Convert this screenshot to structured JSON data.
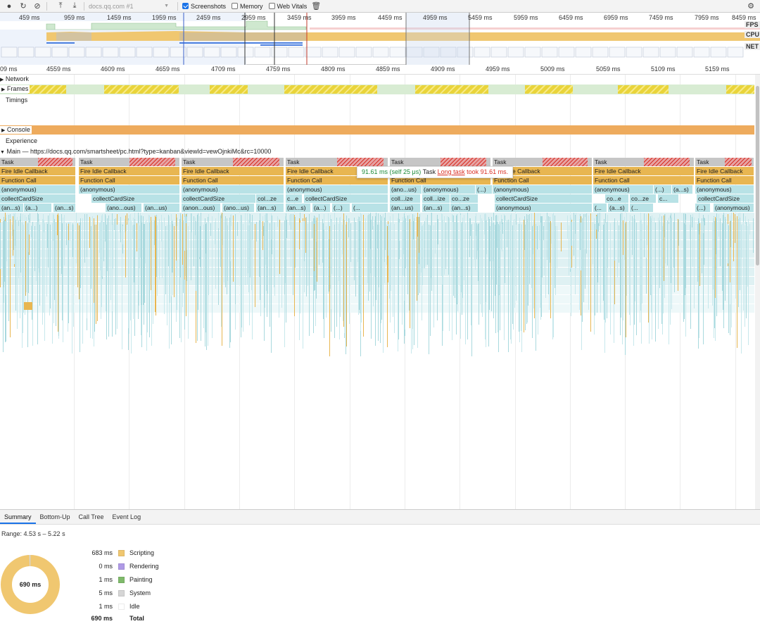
{
  "toolbar": {
    "tab_select": "docs.qq.com #1",
    "screenshots_label": "Screenshots",
    "screenshots_checked": true,
    "memory_label": "Memory",
    "memory_checked": false,
    "webvitals_label": "Web Vitals",
    "webvitals_checked": false
  },
  "overview": {
    "ticks": [
      "459 ms",
      "959 ms",
      "1459 ms",
      "1959 ms",
      "2459 ms",
      "2959 ms",
      "3459 ms",
      "3959 ms",
      "4459 ms",
      "4959 ms",
      "5459 ms",
      "5959 ms",
      "6459 ms",
      "6959 ms",
      "7459 ms",
      "7959 ms",
      "8459 ms"
    ],
    "labels": {
      "fps": "FPS",
      "cpu": "CPU",
      "net": "NET"
    }
  },
  "ruler": {
    "ticks": [
      "09 ms",
      "4559 ms",
      "4609 ms",
      "4659 ms",
      "4709 ms",
      "4759 ms",
      "4809 ms",
      "4859 ms",
      "4909 ms",
      "4959 ms",
      "5009 ms",
      "5059 ms",
      "5109 ms",
      "5159 ms"
    ]
  },
  "tracks": {
    "network": "Network",
    "frames": "Frames",
    "timings": "Timings",
    "console": "Console",
    "experience": "Experience",
    "main": "Main — https://docs.qq.com/smartsheet/pc.html?type=kanban&viewId=vewOjnkiMc&rc=10000"
  },
  "flame": {
    "task": "Task",
    "fire_idle": "Fire Idle Callback",
    "function_call": "Function Call",
    "anonymous": "(anonymous)",
    "collect": "collectCardSize",
    "row6_col0": [
      "(an...s)",
      "(a...)",
      "(an...s)"
    ],
    "row6_col1": [
      "(ano...ous)",
      "(an...us)"
    ],
    "row6_col2": [
      "(anon...ous)",
      "(ano...us)",
      "(an...s)"
    ],
    "row6_col3": [
      "(an...s)",
      "(a...)",
      "(...)",
      "(..."
    ],
    "row6_col4": [
      "(an...us)",
      "(an...s)",
      "(an...s)"
    ],
    "row6_col5": [
      "(anonymous)"
    ],
    "row6_col6": [
      "(...",
      "(a...s)",
      "(..."
    ],
    "row6_col7": [
      "(...)",
      "(anonymous)"
    ],
    "row4_col4": [
      "(ano...us)",
      "(anonymous)",
      "(...)"
    ],
    "row4_col6": [
      "(anonymous)",
      "(...)",
      "(a...s)"
    ],
    "row5_col2b": "col...ze",
    "row5_col3": [
      "c...e",
      "collectCardSize"
    ],
    "row5_col4": [
      "coll...ize",
      "coll...ize",
      "co...ze"
    ],
    "row5_col5": "collectCardSize",
    "row5_col6": [
      "co...e",
      "co...ze",
      "c..."
    ],
    "row5_col7": "collectCardSize"
  },
  "tooltip": {
    "time": "91.61 ms (self 25 μs)",
    "name": "Task",
    "link": "Long task",
    "rest": "took 91.61 ms."
  },
  "bottom": {
    "tabs": [
      "Summary",
      "Bottom-Up",
      "Call Tree",
      "Event Log"
    ],
    "range": "Range: 4.53 s – 5.22 s",
    "donut_total": "690 ms",
    "legend": [
      {
        "value": "683 ms",
        "label": "Scripting",
        "color": "#f0c770"
      },
      {
        "value": "0 ms",
        "label": "Rendering",
        "color": "#af9ae6"
      },
      {
        "value": "1 ms",
        "label": "Painting",
        "color": "#7fba6b"
      },
      {
        "value": "5 ms",
        "label": "System",
        "color": "#d6d6d6"
      },
      {
        "value": "1 ms",
        "label": "Idle",
        "color": "#ffffff"
      }
    ],
    "total_value": "690 ms",
    "total_label": "Total"
  }
}
